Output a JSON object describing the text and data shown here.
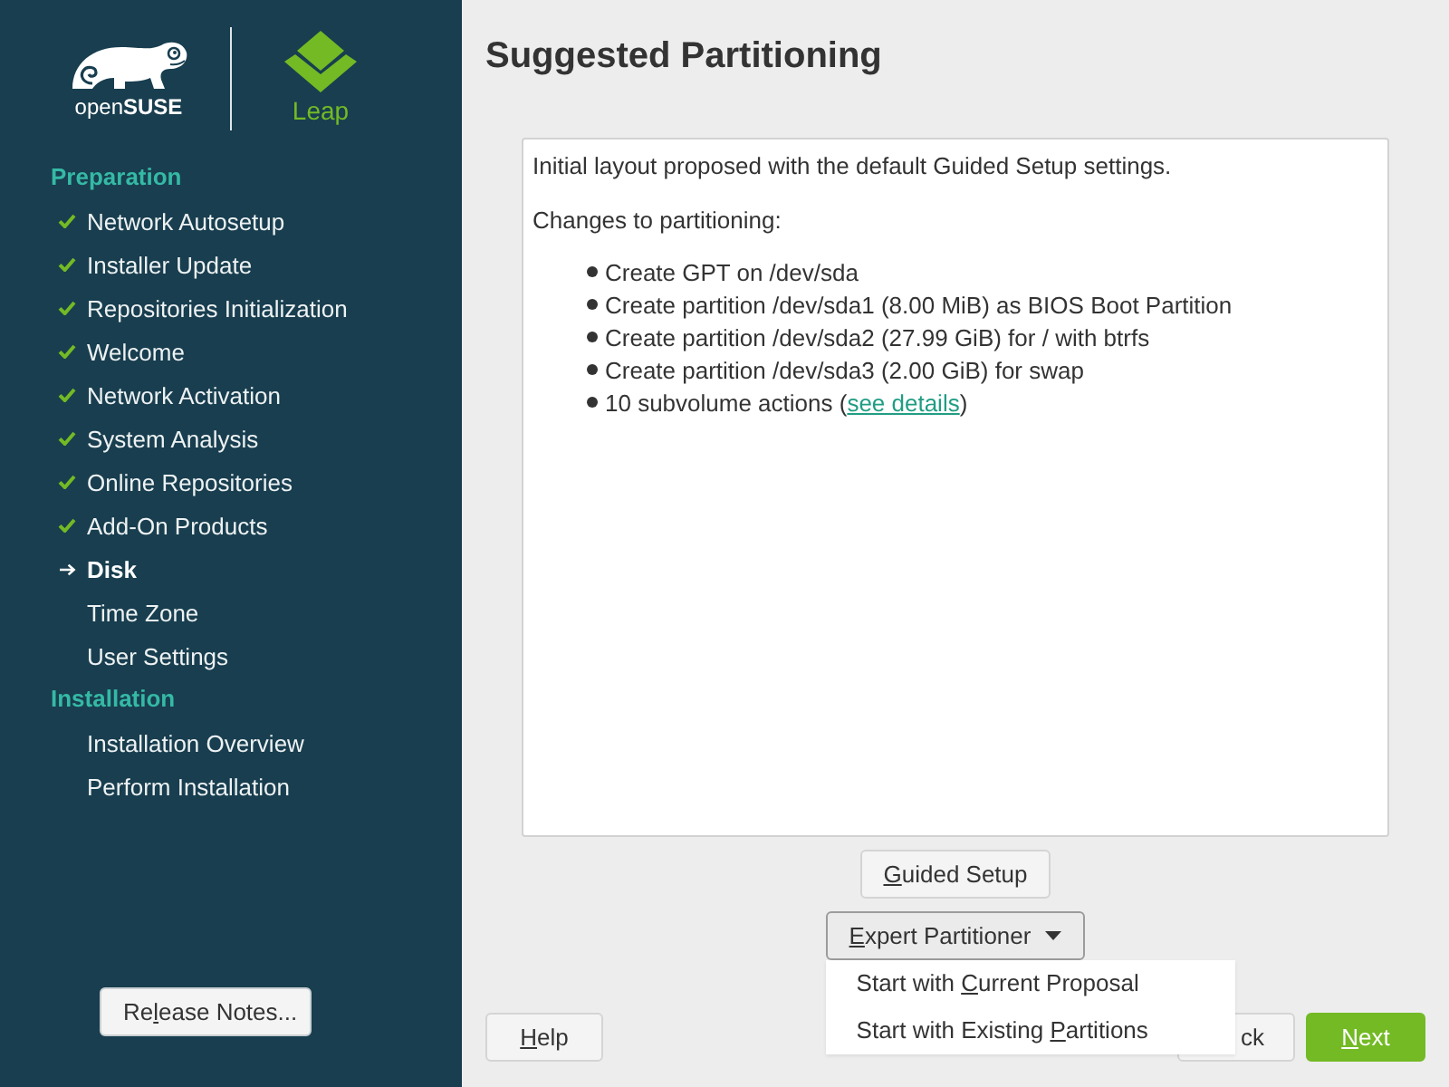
{
  "sidebar": {
    "logo": {
      "brand": "open**SUSE**",
      "product": "Leap"
    },
    "sections": [
      {
        "title": "Preparation",
        "steps": [
          {
            "label": "Network Autosetup",
            "done": true,
            "selected": false
          },
          {
            "label": "Installer Update",
            "done": true,
            "selected": false
          },
          {
            "label": "Repositories Initialization",
            "done": true,
            "selected": false
          },
          {
            "label": "Welcome",
            "done": true,
            "selected": false
          },
          {
            "label": "Network Activation",
            "done": true,
            "selected": false
          },
          {
            "label": "System Analysis",
            "done": true,
            "selected": false
          },
          {
            "label": "Online Repositories",
            "done": true,
            "selected": false
          },
          {
            "label": "Add-On Products",
            "done": true,
            "selected": false
          },
          {
            "label": "Disk",
            "done": false,
            "selected": true
          },
          {
            "label": "Time Zone",
            "done": false,
            "selected": false
          },
          {
            "label": "User Settings",
            "done": false,
            "selected": false
          }
        ]
      },
      {
        "title": "Installation",
        "steps": [
          {
            "label": "Installation Overview",
            "done": false,
            "selected": false
          },
          {
            "label": "Perform Installation",
            "done": false,
            "selected": false
          }
        ]
      }
    ],
    "release_notes_button": {
      "before": "Re",
      "key": "l",
      "after": "ease Notes..."
    }
  },
  "main": {
    "title": "Suggested Partitioning",
    "summary": {
      "intro": "Initial layout proposed with the default Guided Setup settings.",
      "heading": "Changes to partitioning:",
      "changes": [
        {
          "kind": "plain",
          "text": "Create GPT on /dev/sda"
        },
        {
          "kind": "plain",
          "text": "Create partition /dev/sda1 (8.00 MiB) as BIOS Boot Partition"
        },
        {
          "kind": "plain",
          "text": "Create partition /dev/sda2 (27.99 GiB) for / with btrfs"
        },
        {
          "kind": "plain",
          "text": "Create partition /dev/sda3 (2.00 GiB) for swap"
        },
        {
          "kind": "link",
          "text": "10 subvolume actions (",
          "link": "see details",
          "after": ")"
        }
      ]
    },
    "guided_setup_button": {
      "key": "G",
      "after": "uided Setup"
    },
    "expert_partitioner": {
      "label": {
        "key": "E",
        "after": "xpert Partitioner"
      },
      "expanded": true,
      "menu": [
        {
          "before": "Start with ",
          "key": "C",
          "after": "urrent Proposal"
        },
        {
          "before": "Start with Existing ",
          "key": "P",
          "after": "artitions"
        }
      ]
    }
  },
  "footer": {
    "help_button": {
      "key": "H",
      "after": "elp"
    },
    "back_button": {
      "after": "ck"
    },
    "next_button": {
      "key": "N",
      "after": "ext"
    }
  }
}
